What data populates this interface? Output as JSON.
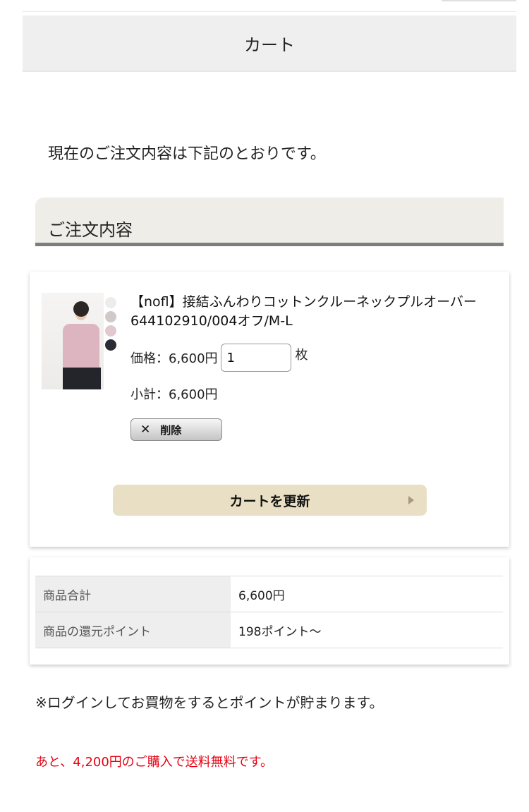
{
  "header": {
    "title": "カート"
  },
  "intro_text": "現在のご注文内容は下記のとおりです。",
  "order_section": {
    "heading": "ご注文内容"
  },
  "item": {
    "name": "【nofl】接結ふんわりコットンクルーネックプルオーバー　644102910/004オフ/M-L",
    "price_label": "価格：6,600円",
    "quantity": "1",
    "unit": "枚",
    "subtotal_label": "小計：6,600円",
    "delete_label": "削除",
    "delete_icon": "close-icon",
    "image_icon": "product-photo",
    "swatch_colors": [
      "#ececec",
      "#cfcac8",
      "#e2c8cf",
      "#2a2c33"
    ]
  },
  "update_button": {
    "label": "カートを更新",
    "icon": "arrow-right-icon"
  },
  "summary": {
    "rows": [
      {
        "label": "商品合計",
        "value": "6,600円"
      },
      {
        "label": "商品の還元ポイント",
        "value": "198ポイント〜"
      }
    ]
  },
  "login_note": "※ログインしてお買物をするとポイントが貯まります。",
  "shipping_note": "あと、4,200円のご購入で送料無料です。",
  "colors": {
    "update_button": "#e9dfc4",
    "shipping_note": "#e60012",
    "section_underline": "#7d7d7d"
  }
}
